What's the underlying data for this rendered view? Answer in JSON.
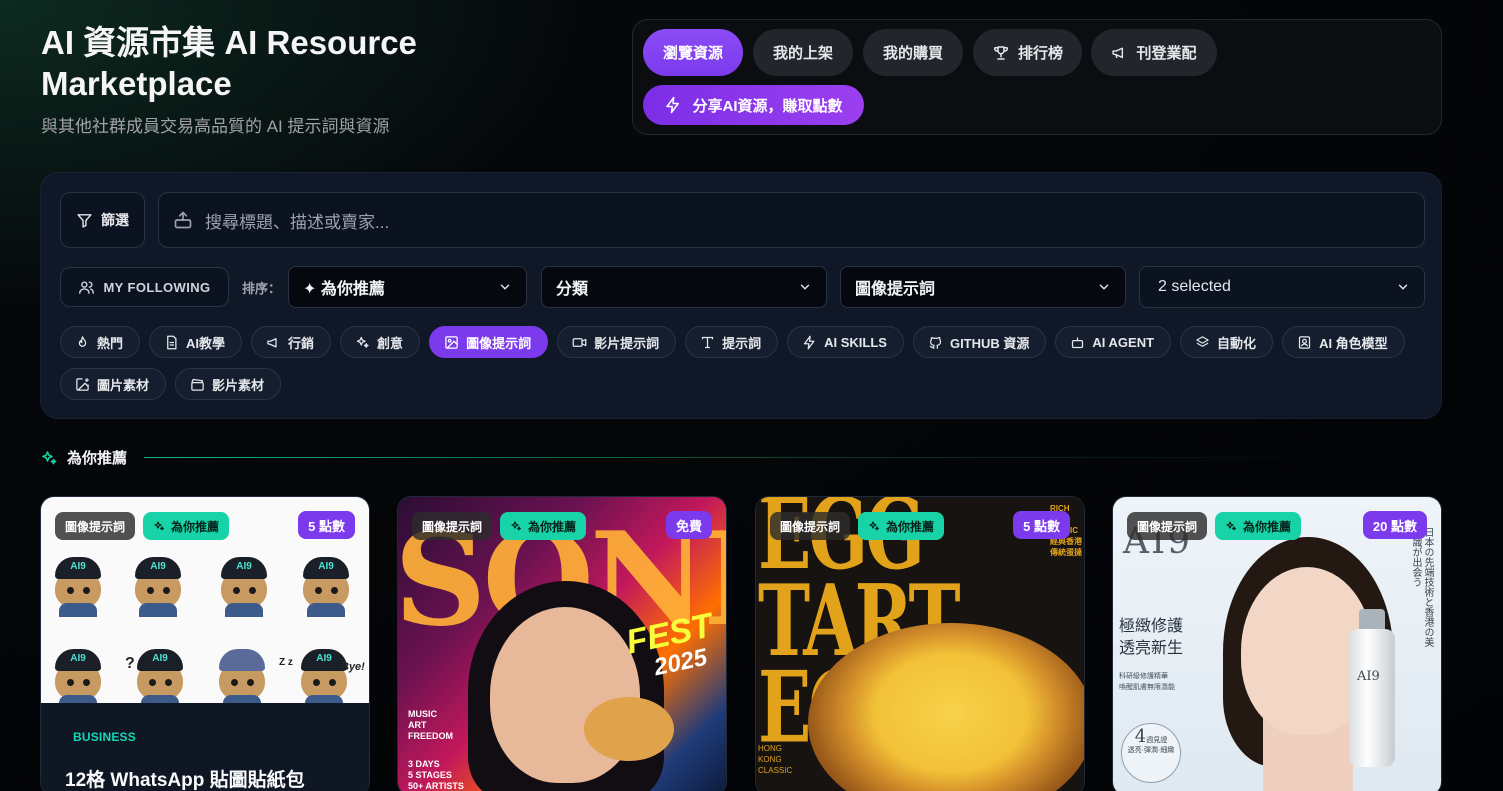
{
  "header": {
    "title": "AI 資源市集 AI Resource Marketplace",
    "subtitle": "與其他社群成員交易高品質的 AI 提示詞與資源"
  },
  "nav": {
    "tabs": [
      {
        "label": "瀏覽資源",
        "active": true
      },
      {
        "label": "我的上架",
        "active": false
      },
      {
        "label": "我的購買",
        "active": false
      },
      {
        "label": "排行榜",
        "icon": "trophy-icon",
        "active": false
      },
      {
        "label": "刊登業配",
        "icon": "megaphone-icon",
        "active": false
      }
    ],
    "share_label": "分享AI資源，賺取點數"
  },
  "filters": {
    "filter_label": "篩選",
    "search_placeholder": "搜尋標題、描述或賣家...",
    "following_label": "MY FOLLOWING",
    "sort_label": "排序：",
    "sort_value": "✦ 為你推薦",
    "category_value": "分類",
    "type_value": "圖像提示詞",
    "multi_value": "2 selected"
  },
  "chips": [
    {
      "label": "熱門",
      "icon": "flame-icon",
      "active": false
    },
    {
      "label": "AI教學",
      "icon": "document-icon",
      "active": false
    },
    {
      "label": "行銷",
      "icon": "megaphone-icon",
      "active": false
    },
    {
      "label": "創意",
      "icon": "sparkles-icon",
      "active": false
    },
    {
      "label": "圖像提示詞",
      "icon": "image-icon",
      "active": true
    },
    {
      "label": "影片提示詞",
      "icon": "video-icon",
      "active": false
    },
    {
      "label": "提示詞",
      "icon": "text-icon",
      "active": false
    },
    {
      "label": "AI SKILLS",
      "icon": "bolt-icon",
      "active": false
    },
    {
      "label": "GITHUB 資源",
      "icon": "github-icon",
      "active": false
    },
    {
      "label": "AI AGENT",
      "icon": "robot-icon",
      "active": false
    },
    {
      "label": "自動化",
      "icon": "layers-icon",
      "active": false
    },
    {
      "label": "AI 角色模型",
      "icon": "portrait-icon",
      "active": false
    },
    {
      "label": "圖片素材",
      "icon": "image-plus-icon",
      "active": false
    },
    {
      "label": "影片素材",
      "icon": "clapperboard-icon",
      "active": false
    }
  ],
  "recommended": {
    "heading": "為你推薦"
  },
  "cards": [
    {
      "type_badge": "圖像提示詞",
      "rec_badge": "為你推薦",
      "price": "5 點數",
      "category": "BUSINESS",
      "title": "12格 WhatsApp 貼圖貼紙包",
      "sticker_cap": "AI9",
      "sticker_words": [
        "?",
        "Bye!",
        "Z z"
      ]
    },
    {
      "type_badge": "圖像提示詞",
      "rec_badge": "為你推薦",
      "price": "免費",
      "art": {
        "big_text": "SONIC",
        "fest": "FEST",
        "year": "2025",
        "side_lines": [
          "MUSIC",
          "ART",
          "FREEDOM"
        ],
        "side_lines2": [
          "3 DAYS",
          "5 STAGES",
          "50+ ARTISTS"
        ]
      }
    },
    {
      "type_badge": "圖像提示詞",
      "rec_badge": "為你推薦",
      "price": "5 點數",
      "art": {
        "big_text": "EGG TART",
        "big_text2": "EGG TA",
        "side_lines": [
          "RICH",
          "...",
          "ICONIC",
          "經典香港",
          "傳統蛋撻"
        ],
        "left_lines": [
          "HONG",
          "KONG",
          "CLASSIC"
        ]
      }
    },
    {
      "type_badge": "圖像提示詞",
      "rec_badge": "為你推薦",
      "price": "20 點數",
      "art": {
        "logo": "AI9",
        "vertical": "日本の先端技術と香港の美意識が出会う",
        "headline": [
          "極緻修護",
          "透亮新生"
        ],
        "small_lines": [
          "科研級修護精華",
          "喚醒肌膚無限潛能"
        ],
        "circle_num": "4",
        "circle_unit": "週見證",
        "circle_sub": "透亮·彈潤·細緻",
        "bottle_text": "AI9"
      }
    }
  ],
  "colors": {
    "accent": "#7c3aed",
    "rec_badge": "#18d3a7",
    "panel": "#101827"
  }
}
